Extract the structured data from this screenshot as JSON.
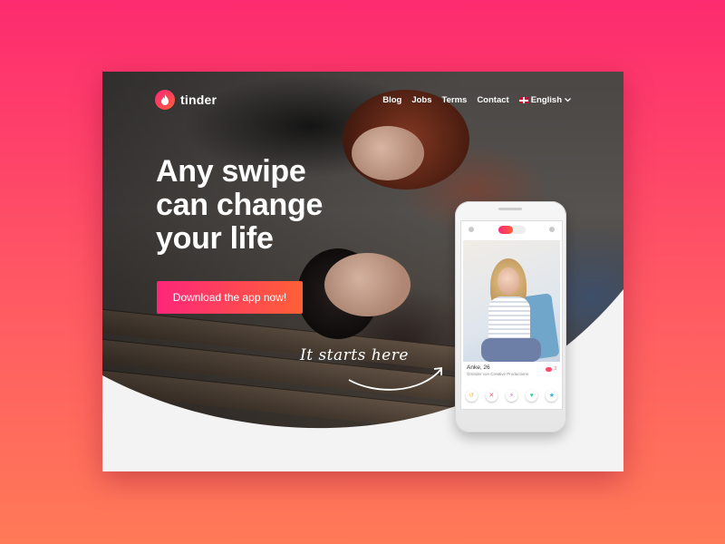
{
  "brand": {
    "name": "tinder"
  },
  "nav": {
    "items": [
      "Blog",
      "Jobs",
      "Terms",
      "Contact"
    ],
    "language": "English"
  },
  "hero": {
    "headline_lines": [
      "Any swipe",
      "can change",
      "your life"
    ],
    "cta_label": "Download the app now!",
    "tagline": "It starts here"
  },
  "phone": {
    "profile_name": "Anke, 26",
    "profile_subtitle": "Gründer von Creative Productions",
    "shared_count": "3",
    "actions": [
      {
        "icon": "rewind-icon",
        "glyph": "↺",
        "color": "#f5b748"
      },
      {
        "icon": "nope-icon",
        "glyph": "✕",
        "color": "#fd5068"
      },
      {
        "icon": "boost-icon",
        "glyph": "⚡",
        "color": "#a95cf6"
      },
      {
        "icon": "like-icon",
        "glyph": "♥",
        "color": "#2dd5a8"
      },
      {
        "icon": "superlike-icon",
        "glyph": "★",
        "color": "#2db4f2"
      }
    ]
  },
  "colors": {
    "accent_start": "#fd267a",
    "accent_end": "#ff6036",
    "background_start": "#fd2b6f",
    "background_end": "#ff7a57"
  }
}
